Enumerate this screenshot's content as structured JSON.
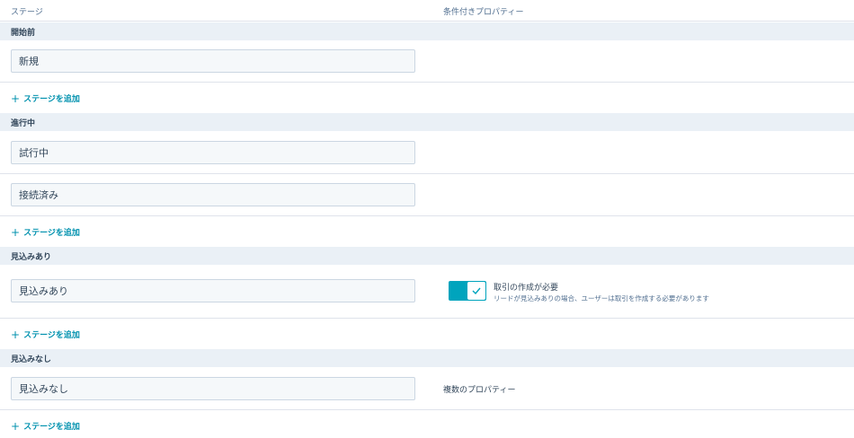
{
  "columns": {
    "stage": "ステージ",
    "conditional_property": "条件付きプロパティー"
  },
  "add_stage_label": "ステージを追加",
  "accent_color": "#00a4bd",
  "sections": [
    {
      "label": "開始前",
      "stages": [
        "新規"
      ]
    },
    {
      "label": "進行中",
      "stages": [
        "試行中",
        "接続済み"
      ]
    },
    {
      "label": "見込みあり",
      "stages": [
        "見込みあり"
      ],
      "toggle": {
        "on": true,
        "title": "取引の作成が必要",
        "description": "リードが見込みありの場合、ユーザーは取引を作成する必要があります"
      }
    },
    {
      "label": "見込みなし",
      "stages": [
        "見込みなし"
      ],
      "property_text": "複数のプロパティー"
    }
  ]
}
